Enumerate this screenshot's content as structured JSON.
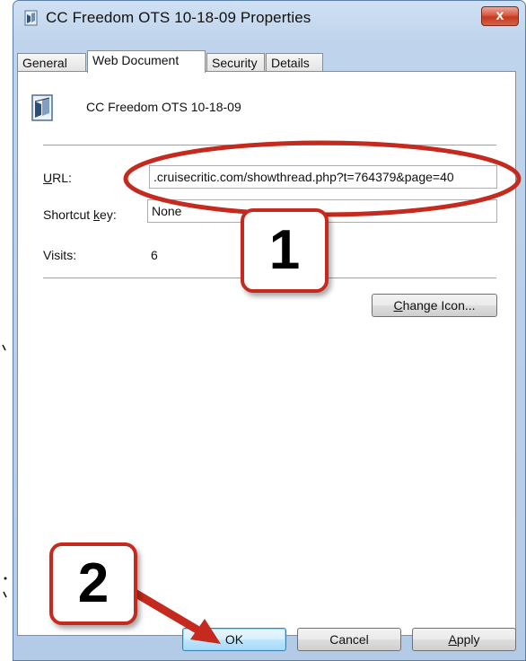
{
  "window": {
    "title": "CC Freedom OTS 10-18-09 Properties",
    "close_label": "x"
  },
  "tabs": [
    {
      "label": "General"
    },
    {
      "label": "Web Document"
    },
    {
      "label": "Security"
    },
    {
      "label": "Details"
    }
  ],
  "document": {
    "name": "CC Freedom OTS 10-18-09"
  },
  "fields": {
    "url_label_accel": "U",
    "url_label_rest": "RL:",
    "url_value": ".cruisecritic.com/showthread.php?t=764379&page=40",
    "shortcut_label_pre": "Shortcut ",
    "shortcut_label_accel": "k",
    "shortcut_label_post": "ey:",
    "shortcut_value": "None",
    "visits_label": "Visits:",
    "visits_value": "6"
  },
  "buttons": {
    "change_icon_accel": "C",
    "change_icon_rest": "hange Icon...",
    "ok": "OK",
    "cancel": "Cancel",
    "apply_accel": "A",
    "apply_rest": "pply"
  },
  "annotations": {
    "step1": "1",
    "step2": "2",
    "color": "#c42a1e"
  }
}
